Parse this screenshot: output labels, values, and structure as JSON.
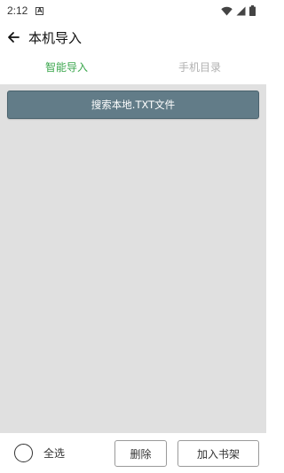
{
  "status_bar": {
    "time": "2:12",
    "indicator": "A",
    "icons": [
      "wifi-icon",
      "signal-icon",
      "battery-icon"
    ]
  },
  "app_bar": {
    "back_icon": "arrow-left-icon",
    "title": "本机导入"
  },
  "tabs": [
    {
      "label": "智能导入",
      "active": true
    },
    {
      "label": "手机目录",
      "active": false
    }
  ],
  "main": {
    "search_button_label": "搜索本地.TXT文件"
  },
  "bottom_bar": {
    "select_all_label": "全选",
    "delete_label": "删除",
    "add_to_shelf_label": "加入书架"
  },
  "colors": {
    "accent": "#3aa64c",
    "search_button": "#627c88",
    "content_background": "#e0e0e0",
    "inactive_tab": "#b0b0b0"
  }
}
